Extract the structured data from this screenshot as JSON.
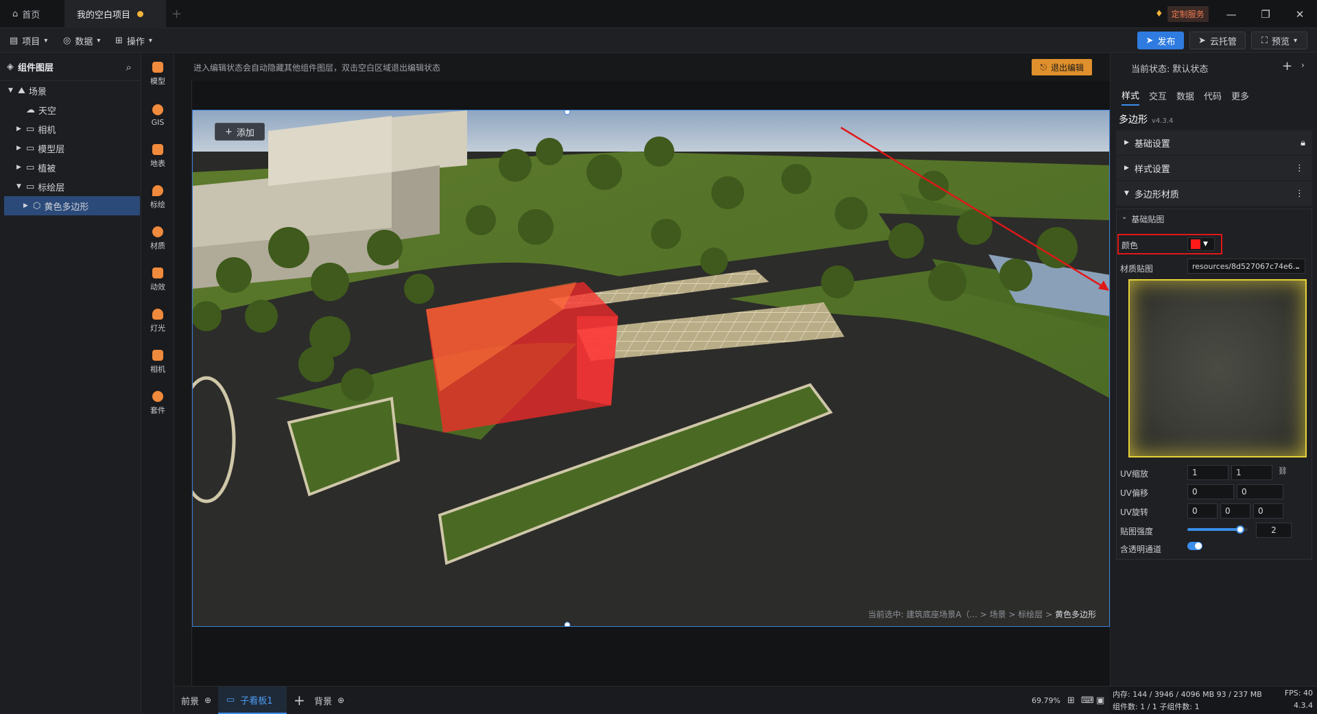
{
  "titlebar": {
    "tabs": [
      {
        "label": "首页"
      },
      {
        "label": "我的空白项目"
      }
    ],
    "custom_service": "定制服务"
  },
  "menubar": {
    "menus": [
      {
        "label": "项目"
      },
      {
        "label": "数据"
      },
      {
        "label": "操作"
      }
    ],
    "publish": "发布",
    "cloud": "云托管",
    "preview": "预览"
  },
  "layers": {
    "title": "组件图层",
    "items": [
      {
        "label": "场景"
      },
      {
        "label": "天空"
      },
      {
        "label": "相机"
      },
      {
        "label": "模型层"
      },
      {
        "label": "植被"
      },
      {
        "label": "标绘层"
      },
      {
        "label": "黄色多边形"
      }
    ]
  },
  "tools": [
    {
      "label": "模型",
      "icon": "model-icon"
    },
    {
      "label": "GIS",
      "icon": "gis-icon"
    },
    {
      "label": "地表",
      "icon": "terrain-icon"
    },
    {
      "label": "标绘",
      "icon": "marker-icon"
    },
    {
      "label": "材质",
      "icon": "material-icon"
    },
    {
      "label": "动效",
      "icon": "effect-icon"
    },
    {
      "label": "灯光",
      "icon": "light-icon"
    },
    {
      "label": "相机",
      "icon": "camera-icon"
    },
    {
      "label": "套件",
      "icon": "kit-icon"
    }
  ],
  "canvas": {
    "notice": "进入编辑状态会自动隐藏其他组件图层，双击空白区域退出编辑状态",
    "exit_edit": "退出编辑",
    "add": "添加",
    "breadcrumb_prefix": "当前选中: 建筑底座场景A（... > 场景 > 标绘层 >",
    "breadcrumb_last": "黄色多边形"
  },
  "bottombar": {
    "front": "前景",
    "board": "子看板1",
    "back": "背景",
    "zoom": "69.79%"
  },
  "rightpanel": {
    "state_label": "当前状态:",
    "state_value": "默认状态",
    "tabs": [
      {
        "label": "样式"
      },
      {
        "label": "交互"
      },
      {
        "label": "数据"
      },
      {
        "label": "代码"
      },
      {
        "label": "更多"
      }
    ],
    "component": "多边形",
    "version": "v4.3.4",
    "sections": [
      {
        "label": "基础设置"
      },
      {
        "label": "样式设置"
      },
      {
        "label": "多边形材质"
      }
    ],
    "subsection": "基础贴图",
    "color_label": "颜色",
    "color_value": "#ff1a1a",
    "texture_label": "材质贴图",
    "texture_value": "resources/8d527067c74e6...",
    "uv_scale_label": "UV缩放",
    "uv_scale": [
      "1",
      "1"
    ],
    "uv_offset_label": "UV偏移",
    "uv_offset": [
      "0",
      "0"
    ],
    "uv_rotate_label": "UV旋转",
    "uv_rotate": [
      "0",
      "0",
      "0"
    ],
    "intensity_label": "贴图强度",
    "intensity_value": "2",
    "intensity_fraction": 0.88,
    "alpha_label": "含透明通道"
  },
  "status": {
    "memory": "内存:  144 / 3946 / 4096 MB  93 / 237 MB",
    "fps": "FPS:  40",
    "components": "组件数: 1 / 1   子组件数: 1",
    "version": "4.3.4"
  }
}
